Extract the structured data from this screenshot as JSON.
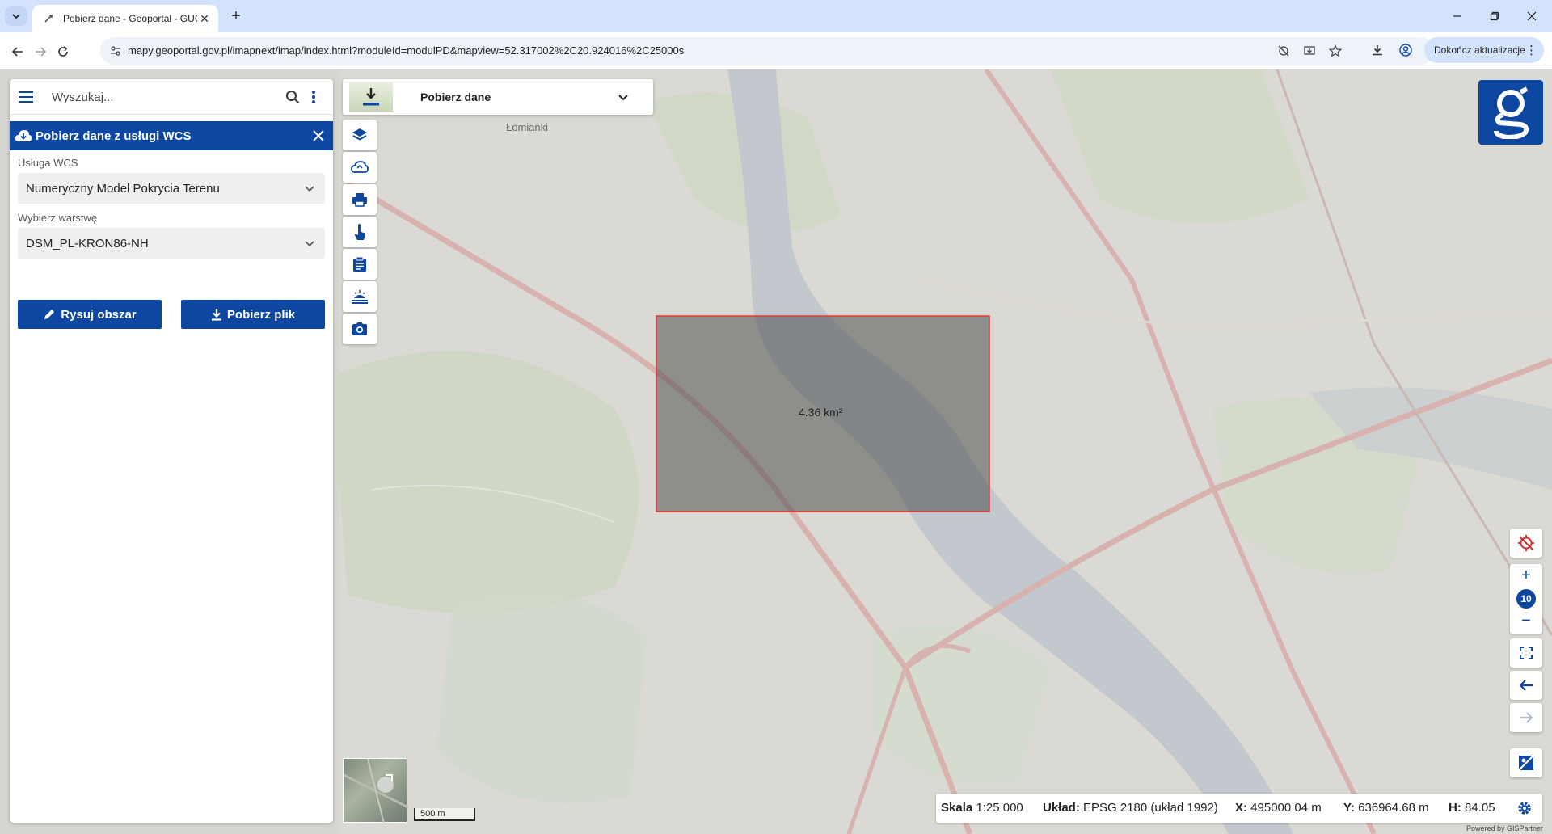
{
  "browser": {
    "tab_title": "Pobierz dane - Geoportal - GUGiK",
    "url": "mapy.geoportal.gov.pl/imapnext/imap/index.html?moduleId=modulPD&mapview=52.317002%2C20.924016%2C25000s",
    "update_label": "Dokończ aktualizacje"
  },
  "search": {
    "placeholder": "Wyszukaj..."
  },
  "wcs_panel": {
    "title": "Pobierz dane z usługi WCS",
    "service_label": "Usługa WCS",
    "service_value": "Numeryczny Model Pokrycia Terenu",
    "layer_label": "Wybierz warstwę",
    "layer_value": "DSM_PL-KRON86-NH",
    "draw_label": "Rysuj obszar",
    "download_label": "Pobierz plik"
  },
  "tool_dropdown": {
    "label": "Pobierz dane"
  },
  "map": {
    "place_label": "Łomianki",
    "area_label": "4.36 km²",
    "zoom_level": "10",
    "scale_bar_label": "500 m"
  },
  "status": {
    "scale_label": "Skala",
    "scale_value": "1:25 000",
    "crs_label": "Układ:",
    "crs_value": "EPSG 2180 (układ 1992)",
    "x_label": "X:",
    "x_value": "495000.04 m",
    "y_label": "Y:",
    "y_value": "636964.68 m",
    "h_label": "H:",
    "h_value": "84.05",
    "powered": "Powered by GISPartner"
  },
  "colors": {
    "accent": "#0d47a1",
    "selection_border": "#e53935"
  }
}
